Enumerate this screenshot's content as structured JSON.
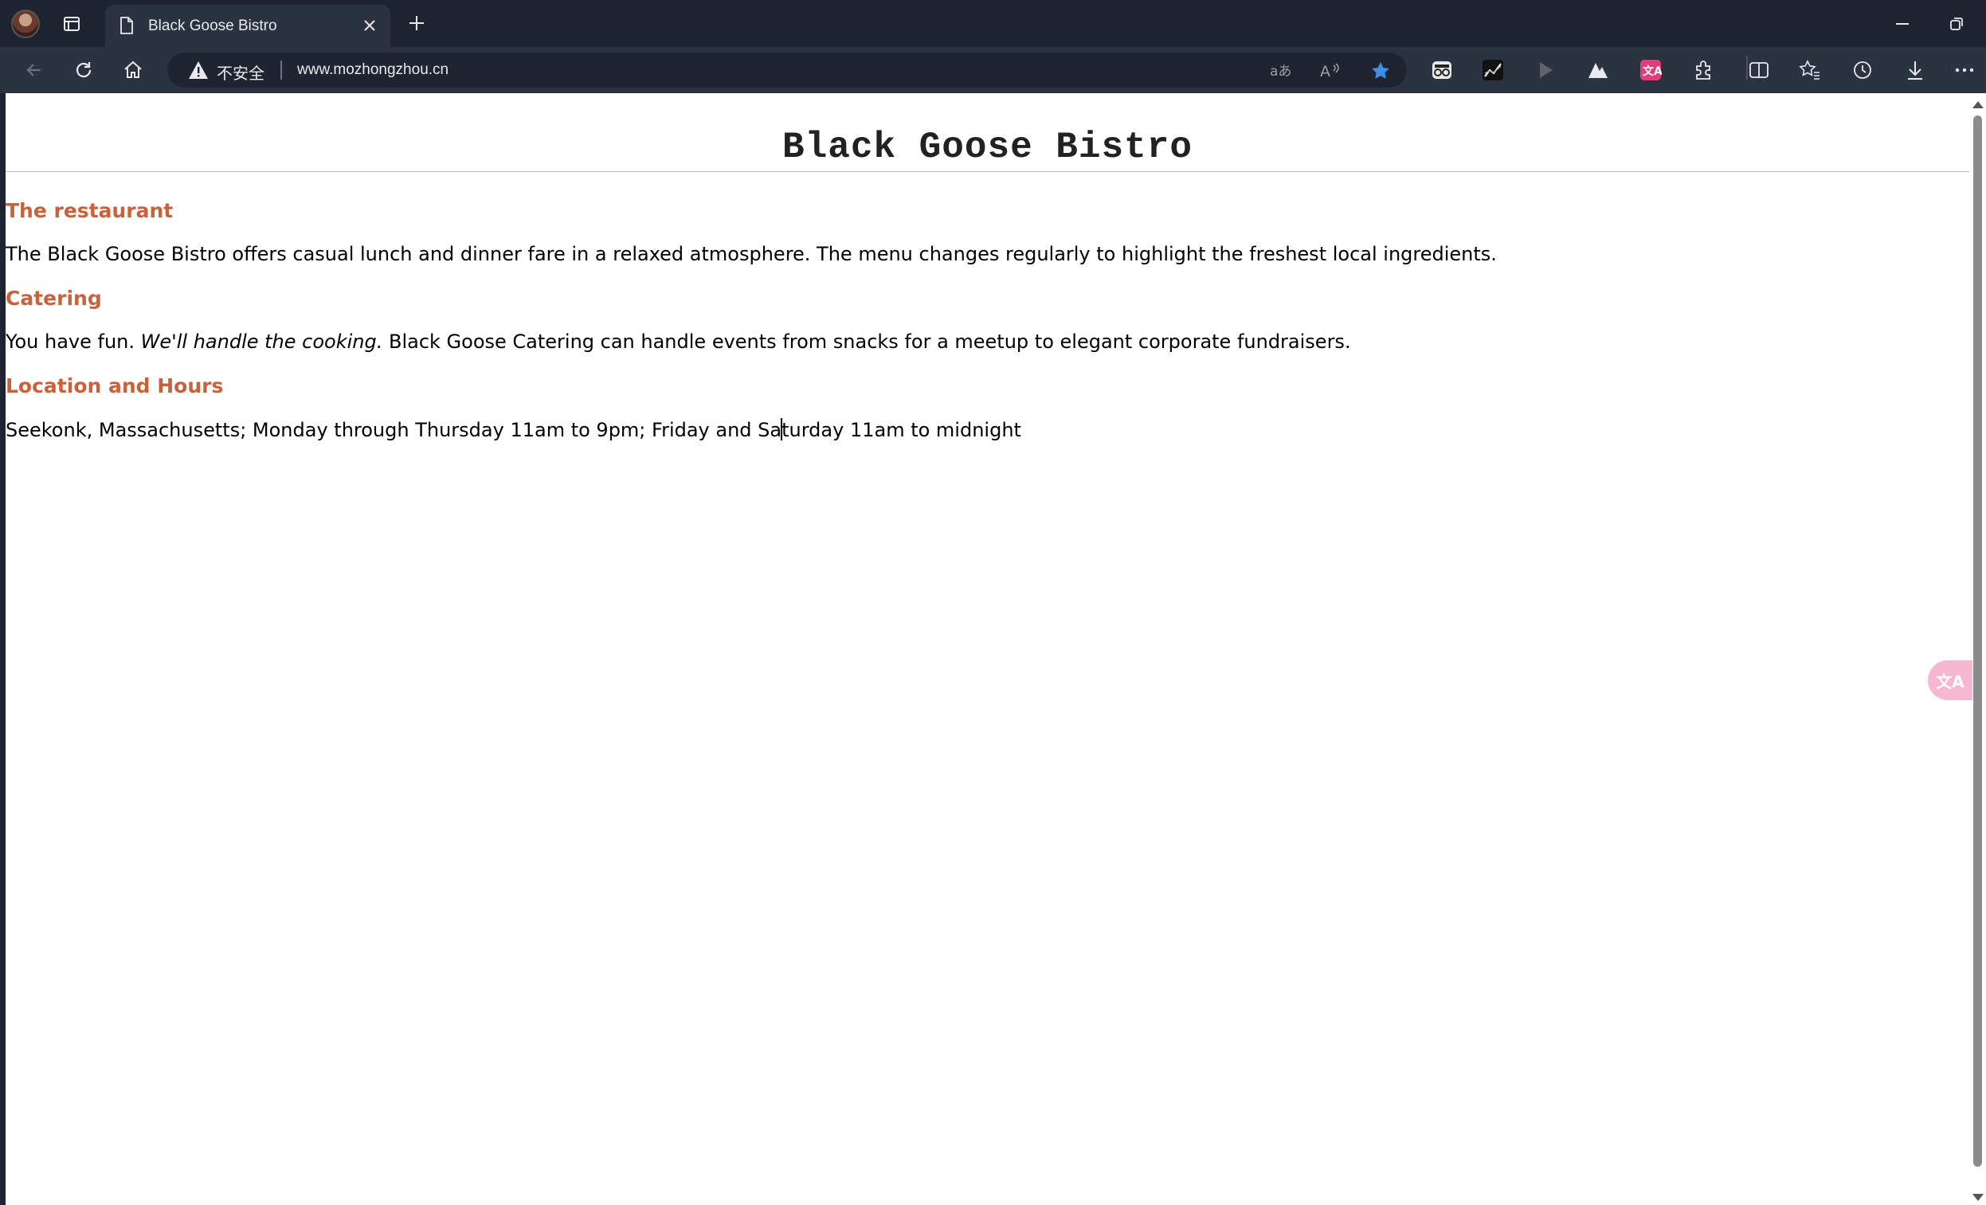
{
  "tab": {
    "title": "Black Goose Bistro"
  },
  "address_bar": {
    "security_label": "不安全",
    "url": "www.mozhongzhou.cn"
  },
  "extensions": {
    "translate_badge": "文A"
  },
  "page": {
    "title": "Black Goose Bistro",
    "sections": [
      {
        "heading": "The restaurant",
        "text": "The Black Goose Bistro offers casual lunch and dinner fare in a relaxed atmosphere. The menu changes regularly to highlight the freshest local ingredients."
      },
      {
        "heading": "Catering",
        "text_before": "You have fun. ",
        "text_em": "We'll handle the cooking.",
        "text_after": " Black Goose Catering can handle events from snacks for a meetup to elegant corporate fundraisers."
      },
      {
        "heading": "Location and Hours",
        "text_part1": "Seekonk, Massachusetts; Monday through Thursday 11am to 9pm; Friday and Sa",
        "text_part2": "turday 11am to midnight"
      }
    ]
  },
  "floating_button": {
    "label": "文A"
  },
  "colors": {
    "heading": "#c8623c",
    "title_rule": "#9fc3d4",
    "favorite_star": "#3b8eea"
  }
}
